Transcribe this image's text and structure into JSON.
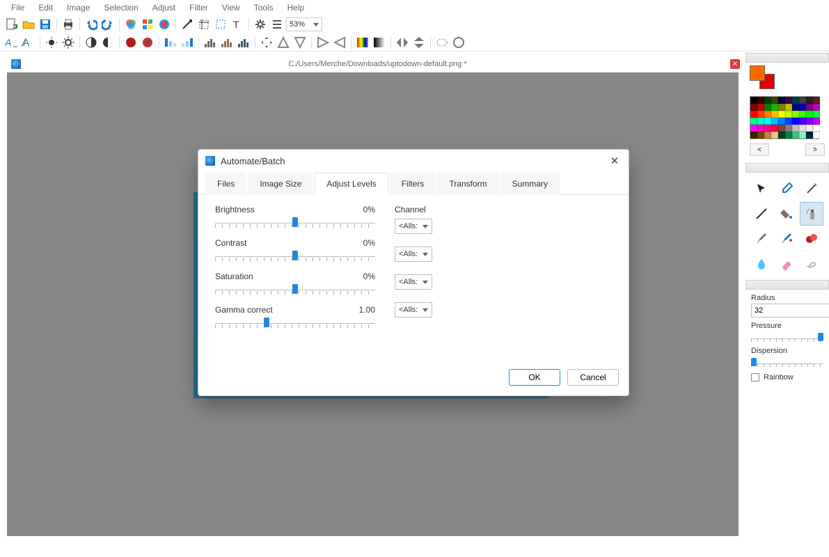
{
  "menu": [
    "File",
    "Edit",
    "Image",
    "Selection",
    "Adjust",
    "Filter",
    "View",
    "Tools",
    "Help"
  ],
  "zoom": "53%",
  "document": {
    "path": "C:/Users/Merche/Downloads/uptodown-default.png *"
  },
  "palette_nav": {
    "prev": "<",
    "next": ">"
  },
  "props": {
    "radius_label": "Radius",
    "radius_value": "32",
    "pressure_label": "Pressure",
    "dispersion_label": "Dispersion",
    "rainbow_label": "Rainbow"
  },
  "dialog": {
    "title": "Automate/Batch",
    "tabs": [
      "Files",
      "Image Size",
      "Adjust Levels",
      "Filters",
      "Transform",
      "Summary"
    ],
    "active_tab": 2,
    "sliders": {
      "brightness": {
        "label": "Brightness",
        "value": "0%",
        "pos": 50
      },
      "contrast": {
        "label": "Contrast",
        "value": "0%",
        "pos": 50
      },
      "saturation": {
        "label": "Saturation",
        "value": "0%",
        "pos": 50
      },
      "gamma": {
        "label": "Gamma correct",
        "value": "1.00",
        "pos": 32
      }
    },
    "channel_label": "Channel",
    "channel_value": "<Alls:",
    "ok": "OK",
    "cancel": "Cancel"
  },
  "palette_colors": [
    "#000000",
    "#400000",
    "#004000",
    "#404000",
    "#000040",
    "#400040",
    "#004040",
    "#404040",
    "#202020",
    "#602020",
    "#800000",
    "#c00000",
    "#008000",
    "#00c000",
    "#808000",
    "#c0c000",
    "#000080",
    "#0000c0",
    "#800080",
    "#c000c0",
    "#ff0000",
    "#ff4000",
    "#ff8000",
    "#ffc000",
    "#ffff00",
    "#c0ff00",
    "#80ff00",
    "#40ff00",
    "#00ff00",
    "#00ff40",
    "#00ff80",
    "#00ffc0",
    "#00ffff",
    "#00c0ff",
    "#0080ff",
    "#0040ff",
    "#0000ff",
    "#4000ff",
    "#8000ff",
    "#c000ff",
    "#ff00ff",
    "#ff00c0",
    "#ff0080",
    "#ff0040",
    "#804040",
    "#808080",
    "#c0c0c0",
    "#e0e0e0",
    "#f0f0f0",
    "#ffffff",
    "#402000",
    "#804000",
    "#c08040",
    "#ffc080",
    "#004020",
    "#008040",
    "#40c080",
    "#80ffc0",
    "#002040",
    "#ffffff"
  ]
}
